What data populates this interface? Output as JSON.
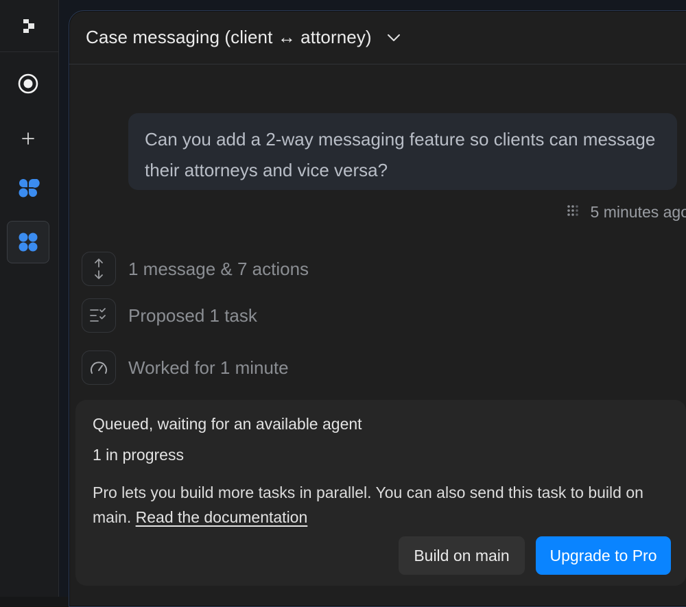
{
  "sidebar": {
    "icons": [
      "logo-icon",
      "record-icon",
      "plus-icon",
      "pinwheel-icon",
      "apps-grid-icon"
    ],
    "accent": "#3b8cf0"
  },
  "header": {
    "title": "Case messaging (client ↔ attorney)"
  },
  "chat": {
    "user_message": "Can you add a 2-way messaging feature so clients can message their attorneys and vice versa?",
    "timestamp": "5 minutes ago",
    "steps": [
      {
        "label": "1 message & 7 actions",
        "icon": "expand-vertical-icon"
      },
      {
        "label": "Proposed 1 task",
        "icon": "checklist-icon"
      },
      {
        "label": "Worked for 1 minute",
        "icon": "speedometer-icon"
      }
    ]
  },
  "queue": {
    "status": "Queued, waiting for an available agent",
    "progress": "1 in progress",
    "info": "Pro lets you build more tasks in parallel. You can also send this task to build on main.",
    "link": "Read the documentation",
    "secondary_button": "Build on main",
    "primary_button": "Upgrade to Pro",
    "primary_color": "#0a84ff"
  }
}
